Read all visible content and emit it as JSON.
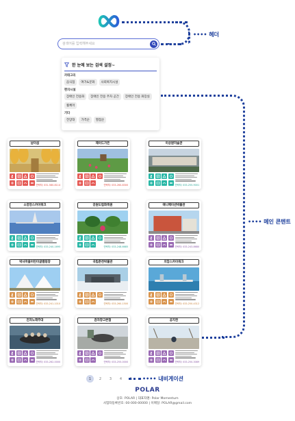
{
  "annotations": {
    "header": "•••• 헤더",
    "main": "•••• 메인 콘텐트",
    "nav": "•••• 내비게이션"
  },
  "search": {
    "placeholder": "검색어를 입력해주세요"
  },
  "filter": {
    "title": "한 눈에 보는 검색 설정~",
    "groups": [
      {
        "label": "카테고리",
        "chips": [
          "음식점",
          "여가&문화",
          "사회복지시설"
        ]
      },
      {
        "label": "편의시설",
        "chips": [
          "장애인 전용화",
          "장애인 전용 주차 공간",
          "장애인 전용 화장실",
          "휠체어"
        ]
      },
      {
        "label": "기타",
        "chips": [
          "전망대",
          "가격순",
          "별점순"
        ]
      }
    ]
  },
  "cards": [
    {
      "title": "남이섬",
      "category": "red",
      "phone": "연락처: 031-580-8114"
    },
    {
      "title": "제이드가든",
      "category": "red",
      "phone": "연락처: 033-260-8300"
    },
    {
      "title": "이상원미술관",
      "category": "green",
      "phone": "연락처: 033-255-9001"
    },
    {
      "title": "소양강스카이워크",
      "category": "green",
      "phone": "연락처: 033-240-1695"
    },
    {
      "title": "강원도립화목원",
      "category": "green",
      "phone": "연락처: 033-248-6685"
    },
    {
      "title": "애니메이션박물관",
      "category": "mix",
      "phone": "연락처: 033-243-8680"
    },
    {
      "title": "박사마을어린이글램핑장",
      "category": "orange",
      "phone": "연락처: 033-241-1010"
    },
    {
      "title": "국립춘천박물관",
      "category": "orange",
      "phone": "연락처: 033-260-1500"
    },
    {
      "title": "의암스카이워크",
      "category": "orange",
      "phone": "연락처: 033-250-4312"
    },
    {
      "title": "진자노래주대",
      "category": "purple",
      "phone": "연락처: 033-262-0000"
    },
    {
      "title": "감자창고본점",
      "category": "purple",
      "phone": "연락처: 033-255-0000"
    },
    {
      "title": "공지천",
      "category": "purple",
      "phone": "연락처: 033-250-3089"
    }
  ],
  "pagination": {
    "pages": [
      "1",
      "2",
      "3",
      "4",
      "5"
    ],
    "active": "1"
  },
  "footer": {
    "brand": "POLAR",
    "line1": "상호: POLAR | 대표자명: Polar Momentum",
    "line2": "사업자등록번호: 00-000-00000 | 이메일: POLAR@gmail.com"
  }
}
